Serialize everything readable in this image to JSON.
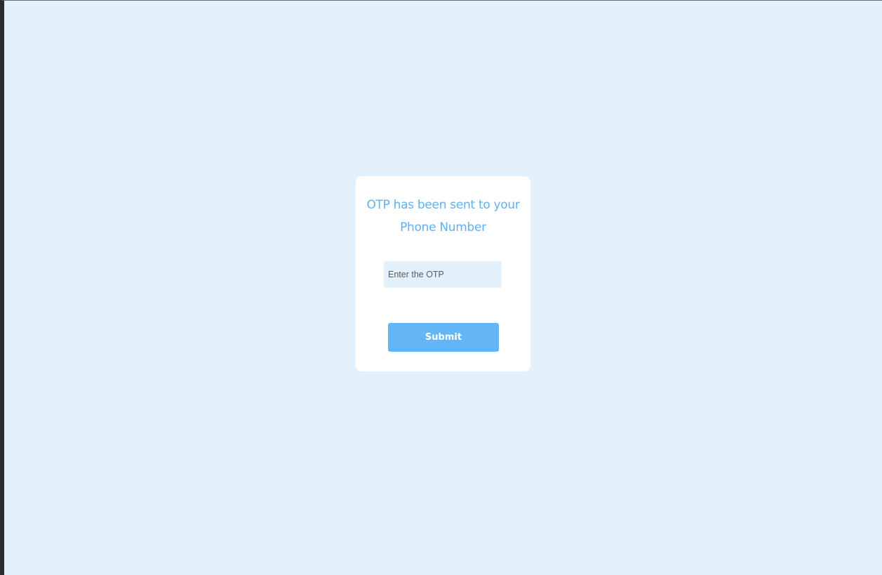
{
  "otp_card": {
    "title_line1": "OTP has been sent to your",
    "title_line2": "Phone Number",
    "otp_input": {
      "value": "",
      "placeholder": "Enter the OTP"
    },
    "submit_label": "Submit"
  },
  "colors": {
    "page_background": "#e3f1fc",
    "card_background": "#ffffff",
    "title_text": "#5fb0f2",
    "input_background": "#e3f1fc",
    "button_background": "#64b5f6",
    "button_text": "#ffffff"
  }
}
